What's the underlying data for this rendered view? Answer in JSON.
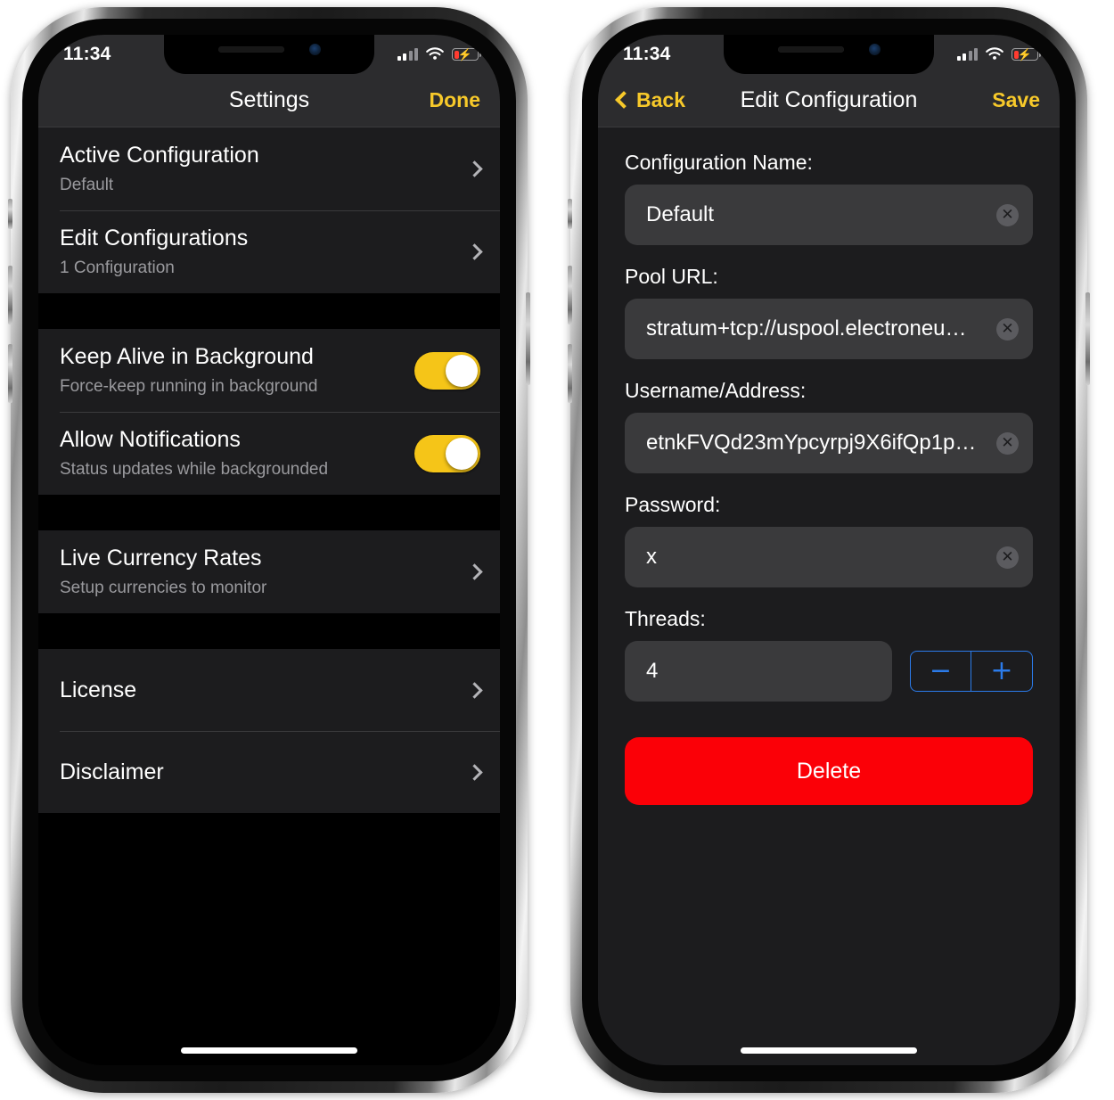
{
  "status_bar": {
    "time": "11:34",
    "cellular_icon": "cellular-bars-icon",
    "wifi_icon": "wifi-icon",
    "battery_icon": "battery-charging-low-icon",
    "battery_level_percent": 22
  },
  "colors": {
    "accent_gold": "#F5C518",
    "toggle_on": "#F5C518",
    "stepper_blue": "#2B7BEA",
    "delete_red": "#FB0007",
    "screen_bg": "#000000",
    "group_bg": "#1C1C1E",
    "bar_bg": "#2C2C2E",
    "field_bg": "#3A3A3C",
    "subtitle_gray": "#9A9A9E"
  },
  "settings_screen": {
    "nav": {
      "title": "Settings",
      "right_action": "Done"
    },
    "groups": [
      {
        "rows": [
          {
            "title": "Active Configuration",
            "subtitle": "Default",
            "accessory": "chevron"
          },
          {
            "title": "Edit Configurations",
            "subtitle": "1 Configuration",
            "accessory": "chevron"
          }
        ]
      },
      {
        "rows": [
          {
            "title": "Keep Alive in Background",
            "subtitle": "Force-keep running in background",
            "accessory": "switch",
            "switch_on": true
          },
          {
            "title": "Allow Notifications",
            "subtitle": "Status updates while backgrounded",
            "accessory": "switch",
            "switch_on": true
          }
        ]
      },
      {
        "rows": [
          {
            "title": "Live Currency Rates",
            "subtitle": "Setup currencies to monitor",
            "accessory": "chevron"
          }
        ]
      },
      {
        "rows": [
          {
            "title": "License",
            "subtitle": "",
            "accessory": "chevron"
          },
          {
            "title": "Disclaimer",
            "subtitle": "",
            "accessory": "chevron"
          }
        ]
      }
    ]
  },
  "edit_configuration_screen": {
    "nav": {
      "left_action": "Back",
      "title": "Edit Configuration",
      "right_action": "Save"
    },
    "fields": [
      {
        "label": "Configuration Name:",
        "value": "Default",
        "clear_icon": "clear-circle-icon"
      },
      {
        "label": "Pool URL:",
        "value": "stratum+tcp://uspool.electroneu…",
        "clear_icon": "clear-circle-icon"
      },
      {
        "label": "Username/Address:",
        "value": "etnkFVQd23mYpcyrpj9X6ifQp1p…",
        "clear_icon": "clear-circle-icon"
      },
      {
        "label": "Password:",
        "value": "x",
        "clear_icon": "clear-circle-icon"
      }
    ],
    "threads": {
      "label": "Threads:",
      "value": "4",
      "decrement_label": "−",
      "increment_label": "+"
    },
    "delete_label": "Delete"
  }
}
